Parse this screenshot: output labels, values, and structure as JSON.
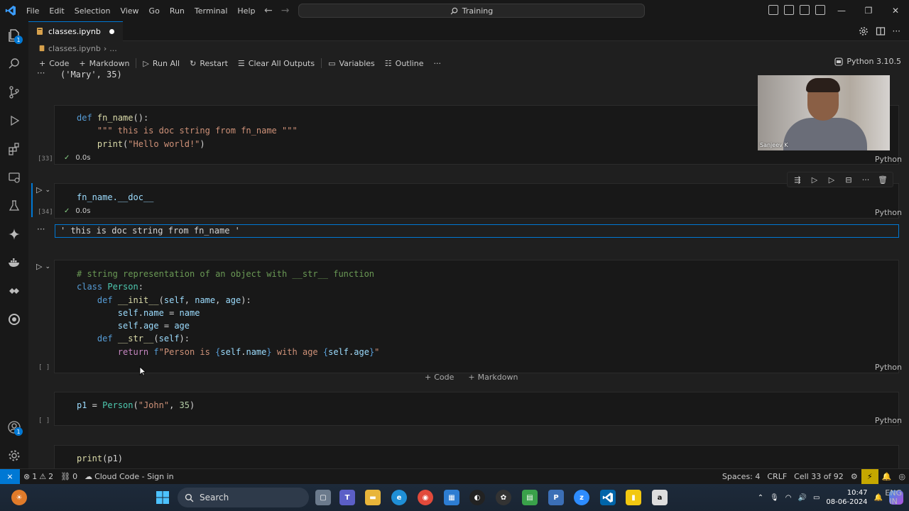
{
  "titlebar": {
    "menu": [
      "File",
      "Edit",
      "Selection",
      "View",
      "Go",
      "Run",
      "Terminal",
      "Help"
    ],
    "search_text": "Training"
  },
  "activity": {
    "explorer_badge": "1",
    "account_badge": "1"
  },
  "tab": {
    "label": "classes.ipynb"
  },
  "breadcrumb": {
    "file": "classes.ipynb",
    "rest": "..."
  },
  "toolbar": {
    "code": "Code",
    "markdown": "Markdown",
    "run_all": "Run All",
    "restart": "Restart",
    "clear": "Clear All Outputs",
    "variables": "Variables",
    "outline": "Outline",
    "more": "···",
    "kernel": "Python 3.10.5"
  },
  "cells": {
    "out0": "('Mary', 35)",
    "c33": {
      "exec": "[33]",
      "time": "0.0s",
      "lang": "Python"
    },
    "c34": {
      "code": "fn_name.__doc__",
      "exec": "[34]",
      "time": "0.0s",
      "lang": "Python",
      "output": "' this is doc string from fn_name '"
    },
    "c35": {
      "exec": "[ ]",
      "lang": "Python"
    },
    "c36": {
      "code_var": "p1",
      "code_eq": " = ",
      "code_cls": "Person",
      "code_open": "(",
      "code_str": "\"John\"",
      "code_comma": ", ",
      "code_num": "35",
      "code_close": ")",
      "exec": "[ ]",
      "lang": "Python"
    },
    "c37": {
      "code_fn": "print",
      "code_args": "(p1)"
    },
    "add_code": "Code",
    "add_markdown": "Markdown"
  },
  "webcam": {
    "name": "Sanjeev K"
  },
  "statusbar": {
    "errors": "1",
    "warnings": "2",
    "ports": "0",
    "cloud": "Cloud Code - Sign in",
    "spaces": "Spaces: 4",
    "eol": "CRLF",
    "cell": "Cell 33 of 92"
  },
  "taskbar": {
    "search": "Search",
    "lang_top": "ENG",
    "lang_bottom": "IN",
    "time": "10:47",
    "date": "08-06-2024"
  }
}
